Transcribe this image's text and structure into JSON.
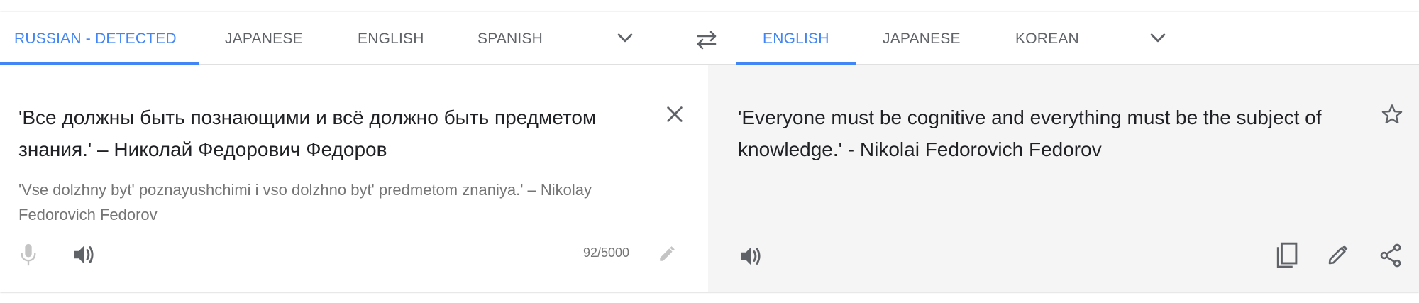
{
  "source_tabs": [
    {
      "label": "RUSSIAN - DETECTED",
      "active": true
    },
    {
      "label": "JAPANESE",
      "active": false
    },
    {
      "label": "ENGLISH",
      "active": false
    },
    {
      "label": "SPANISH",
      "active": false
    }
  ],
  "target_tabs": [
    {
      "label": "ENGLISH",
      "active": true
    },
    {
      "label": "JAPANESE",
      "active": false
    },
    {
      "label": "KOREAN",
      "active": false
    }
  ],
  "source": {
    "text": "'Все должны быть познающими и всё должно быть предметом знания.' – Николай Федорович Федоров",
    "transliteration": "'Vse dolzhny byt' poznayushchimi i vso dolzhno byt' predmetom znaniya.' – Nikolay Fedorovich Fedorov",
    "char_count": "92/5000"
  },
  "target": {
    "text": "'Everyone must be cognitive and everything must be the subject of knowledge.' - Nikolai Fedorovich Fedorov"
  },
  "icons": {
    "clear": "close-icon",
    "mic": "microphone-icon",
    "speaker": "speaker-icon",
    "edit": "pencil-icon",
    "star": "star-icon",
    "copy": "copy-icon",
    "share": "share-icon",
    "swap": "swap-languages-icon",
    "more": "chevron-down-icon"
  },
  "colors": {
    "accent": "#4285f4",
    "tab_inactive": "#5f6368",
    "text": "#202124",
    "secondary_text": "#757575",
    "right_panel_bg": "#f5f5f5"
  }
}
